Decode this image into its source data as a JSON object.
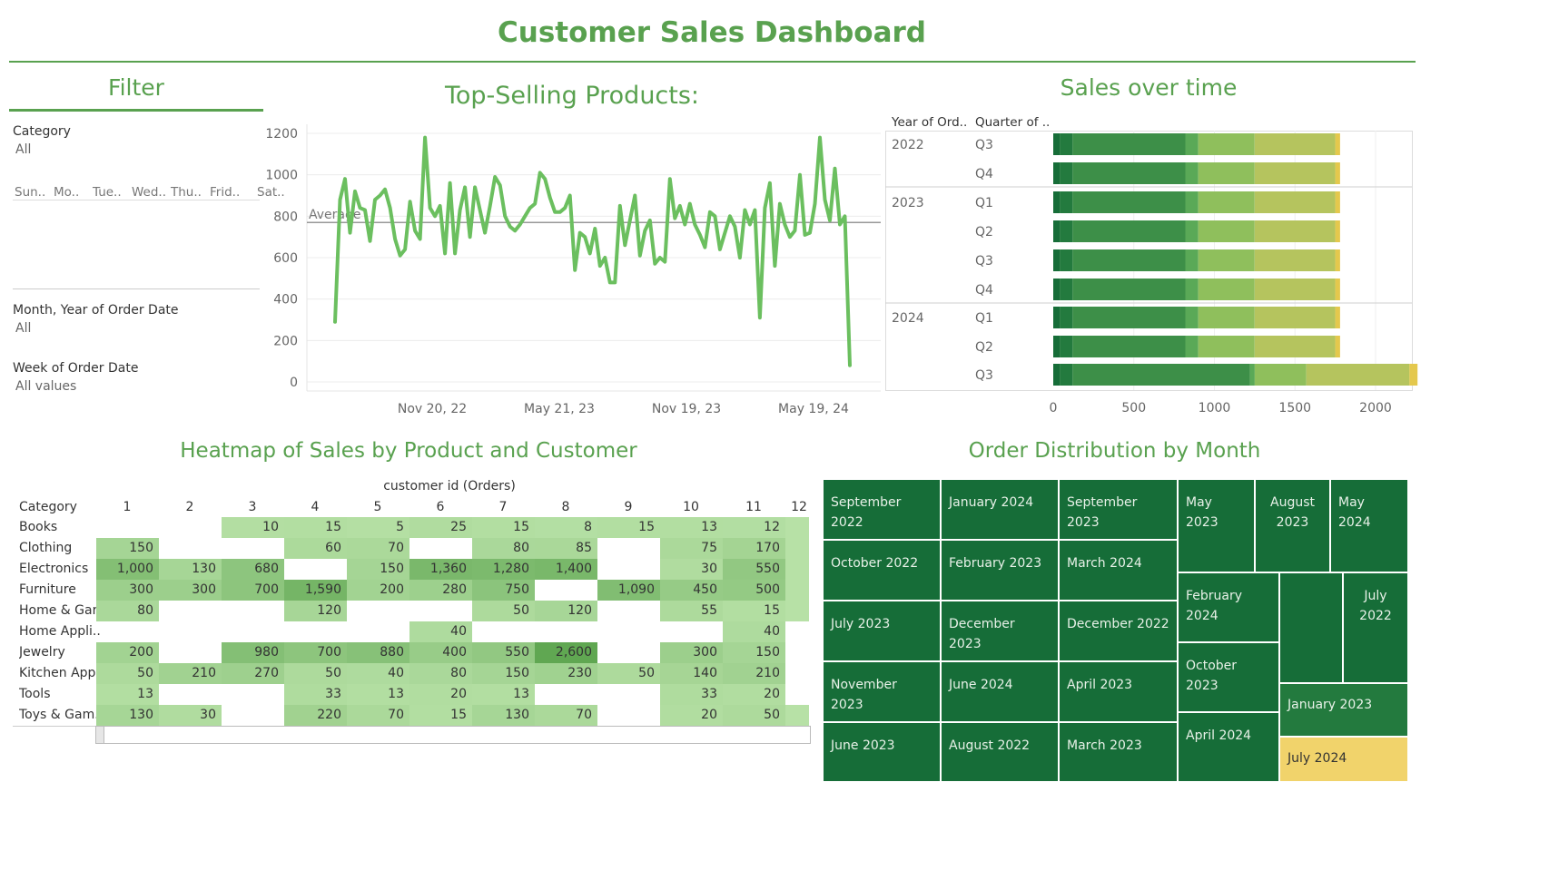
{
  "dashboard": {
    "title": "Customer Sales Dashboard"
  },
  "filter": {
    "title": "Filter",
    "category_label": "Category",
    "category_value": "All",
    "days": [
      "Sun..",
      "Mo..",
      "Tue..",
      "Wed..",
      "Thu..",
      "Frid..",
      "Sat.."
    ],
    "month_label": "Month, Year of Order Date",
    "month_value": "All",
    "week_label": "Week of Order Date",
    "week_value": "All values"
  },
  "line_chart": {
    "title": "Top-Selling Products:",
    "average_label": "Average",
    "y_ticks": [
      "1200",
      "1000",
      "800",
      "600",
      "400",
      "200",
      "0"
    ],
    "x_ticks": [
      "Nov 20, 22",
      "May 21, 23",
      "Nov 19, 23",
      "May 19, 24"
    ]
  },
  "bar_chart": {
    "title": "Sales over time",
    "col_year": "Year of Ord..",
    "col_quarter": "Quarter of ..",
    "x_ticks": [
      "0",
      "500",
      "1000",
      "1500",
      "2000"
    ],
    "rows": [
      {
        "year": "2022",
        "quarter": "Q3"
      },
      {
        "year": "",
        "quarter": "Q4"
      },
      {
        "year": "2023",
        "quarter": "Q1"
      },
      {
        "year": "",
        "quarter": "Q2"
      },
      {
        "year": "",
        "quarter": "Q3"
      },
      {
        "year": "",
        "quarter": "Q4"
      },
      {
        "year": "2024",
        "quarter": "Q1"
      },
      {
        "year": "",
        "quarter": "Q2"
      },
      {
        "year": "",
        "quarter": "Q3"
      }
    ]
  },
  "heatmap": {
    "title": "Heatmap of Sales by Product and Customer",
    "col_header": "customer id (Orders)",
    "row_header": "Category",
    "columns": [
      "1",
      "2",
      "3",
      "4",
      "5",
      "6",
      "7",
      "8",
      "9",
      "10",
      "11",
      "12"
    ],
    "rows": [
      {
        "label": "Books",
        "values": [
          null,
          null,
          10,
          15,
          5,
          25,
          15,
          8,
          15,
          13,
          12,
          null
        ]
      },
      {
        "label": "Clothing",
        "values": [
          150,
          null,
          null,
          60,
          70,
          null,
          80,
          85,
          null,
          75,
          170,
          null
        ]
      },
      {
        "label": "Electronics",
        "values": [
          1000,
          130,
          680,
          null,
          150,
          1360,
          1280,
          1400,
          null,
          30,
          550,
          null
        ]
      },
      {
        "label": "Furniture",
        "values": [
          300,
          300,
          700,
          1590,
          200,
          280,
          750,
          null,
          1090,
          450,
          500,
          null
        ]
      },
      {
        "label": "Home & Gar..",
        "values": [
          80,
          null,
          null,
          120,
          null,
          null,
          50,
          120,
          null,
          55,
          15,
          null
        ]
      },
      {
        "label": "Home Appli..",
        "values": [
          null,
          null,
          null,
          null,
          null,
          40,
          null,
          null,
          null,
          null,
          40,
          null
        ]
      },
      {
        "label": "Jewelry",
        "values": [
          200,
          null,
          980,
          700,
          880,
          400,
          550,
          2600,
          null,
          300,
          150,
          null
        ]
      },
      {
        "label": "Kitchen App..",
        "values": [
          50,
          210,
          270,
          50,
          40,
          80,
          150,
          230,
          50,
          140,
          210,
          null
        ]
      },
      {
        "label": "Tools",
        "values": [
          13,
          null,
          null,
          33,
          13,
          20,
          13,
          null,
          null,
          33,
          20,
          null
        ]
      },
      {
        "label": "Toys & Gam..",
        "values": [
          130,
          30,
          null,
          220,
          70,
          15,
          130,
          70,
          null,
          20,
          50,
          null
        ]
      }
    ],
    "display": [
      [
        null,
        null,
        "10",
        "15",
        "5",
        "25",
        "15",
        "8",
        "15",
        "13",
        "12",
        null
      ],
      [
        "150",
        null,
        null,
        "60",
        "70",
        null,
        "80",
        "85",
        null,
        "75",
        "170",
        null
      ],
      [
        "1,000",
        "130",
        "680",
        null,
        "150",
        "1,360",
        "1,280",
        "1,400",
        null,
        "30",
        "550",
        null
      ],
      [
        "300",
        "300",
        "700",
        "1,590",
        "200",
        "280",
        "750",
        null,
        "1,090",
        "450",
        "500",
        null
      ],
      [
        "80",
        null,
        null,
        "120",
        null,
        null,
        "50",
        "120",
        null,
        "55",
        "15",
        null
      ],
      [
        null,
        null,
        null,
        null,
        null,
        "40",
        null,
        null,
        null,
        null,
        "40",
        null
      ],
      [
        "200",
        null,
        "980",
        "700",
        "880",
        "400",
        "550",
        "2,600",
        null,
        "300",
        "150",
        null
      ],
      [
        "50",
        "210",
        "270",
        "50",
        "40",
        "80",
        "150",
        "230",
        "50",
        "140",
        "210",
        null
      ],
      [
        "13",
        null,
        null,
        "33",
        "13",
        "20",
        "13",
        null,
        null,
        "33",
        "20",
        null
      ],
      [
        "130",
        "30",
        null,
        "220",
        "70",
        "15",
        "130",
        "70",
        null,
        "20",
        "50",
        null
      ]
    ],
    "fill_only": [
      [
        false,
        false,
        false,
        false,
        false,
        false,
        false,
        false,
        false,
        false,
        false,
        true
      ],
      [
        false,
        false,
        false,
        false,
        false,
        false,
        false,
        false,
        false,
        false,
        false,
        true
      ],
      [
        false,
        false,
        false,
        false,
        false,
        false,
        false,
        false,
        false,
        false,
        false,
        true
      ],
      [
        false,
        false,
        false,
        false,
        false,
        false,
        false,
        false,
        false,
        false,
        false,
        true
      ],
      [
        false,
        false,
        false,
        false,
        false,
        false,
        false,
        false,
        false,
        false,
        false,
        true
      ],
      [
        false,
        false,
        false,
        false,
        false,
        false,
        false,
        false,
        false,
        false,
        false,
        false
      ],
      [
        false,
        false,
        false,
        false,
        false,
        false,
        false,
        false,
        false,
        false,
        false,
        false
      ],
      [
        false,
        false,
        false,
        false,
        false,
        false,
        false,
        false,
        false,
        false,
        false,
        false
      ],
      [
        false,
        false,
        false,
        false,
        false,
        false,
        false,
        false,
        false,
        false,
        false,
        false
      ],
      [
        false,
        false,
        false,
        false,
        false,
        false,
        false,
        false,
        false,
        false,
        false,
        true
      ]
    ]
  },
  "treemap": {
    "title": "Order Distribution by Month",
    "cells": [
      {
        "label": "September 2022"
      },
      {
        "label": "January 2024"
      },
      {
        "label": "September 2023"
      },
      {
        "label": "October 2022"
      },
      {
        "label": "February 2023"
      },
      {
        "label": "March 2024"
      },
      {
        "label": "July 2023"
      },
      {
        "label": "December 2023"
      },
      {
        "label": "December 2022"
      },
      {
        "label": "November 2023"
      },
      {
        "label": "June 2024"
      },
      {
        "label": "April 2023"
      },
      {
        "label": "June 2023"
      },
      {
        "label": "August 2022"
      },
      {
        "label": "March 2023"
      },
      {
        "label": "May 2023"
      },
      {
        "label": "August\n2023"
      },
      {
        "label": "May 2024"
      },
      {
        "label": "February 2024"
      },
      {
        "label": ""
      },
      {
        "label": "July\n2022"
      },
      {
        "label": "October 2023"
      },
      {
        "label": "January 2023"
      },
      {
        "label": "April 2024"
      },
      {
        "label": "July 2024"
      }
    ]
  },
  "colors": {
    "accent": "#59a14f",
    "line": "#6bbf5f",
    "treemap_dark": "#166d38",
    "treemap_mid": "#237a3e",
    "treemap_highlight": "#f1d36b"
  },
  "chart_data": [
    {
      "type": "line",
      "title": "Top-Selling Products:",
      "x_ticks": [
        "Nov 20, 22",
        "May 21, 23",
        "Nov 19, 23",
        "May 19, 24"
      ],
      "ylim": [
        0,
        1200
      ],
      "reference_line": {
        "label": "Average",
        "value": 770
      },
      "values": [
        290,
        880,
        980,
        720,
        920,
        840,
        830,
        680,
        880,
        900,
        930,
        840,
        690,
        610,
        640,
        870,
        730,
        690,
        1180,
        840,
        800,
        850,
        620,
        960,
        620,
        830,
        940,
        700,
        940,
        830,
        720,
        850,
        990,
        950,
        800,
        750,
        730,
        760,
        800,
        840,
        860,
        1010,
        980,
        890,
        820,
        820,
        840,
        900,
        540,
        720,
        700,
        620,
        740,
        560,
        600,
        480,
        480,
        850,
        660,
        780,
        900,
        610,
        730,
        780,
        570,
        600,
        580,
        980,
        790,
        850,
        760,
        860,
        760,
        710,
        650,
        820,
        800,
        640,
        720,
        800,
        750,
        600,
        830,
        760,
        830,
        310,
        840,
        960,
        560,
        860,
        760,
        700,
        730,
        1000,
        710,
        720,
        860,
        1180,
        880,
        780,
        1030,
        760,
        800,
        80
      ]
    },
    {
      "type": "bar",
      "title": "Sales over time",
      "orientation": "horizontal",
      "stacked": true,
      "categories": [
        "2022 Q3",
        "2022 Q4",
        "2023 Q1",
        "2023 Q2",
        "2023 Q3",
        "2023 Q4",
        "2024 Q1",
        "2024 Q2",
        "2024 Q3"
      ],
      "segment_colors": [
        "#166d38",
        "#237a3e",
        "#3d8f48",
        "#5aa957",
        "#8fbf5c",
        "#b5c45e",
        "#e4c84d"
      ],
      "segments": [
        [
          40,
          40,
          40,
          40,
          40,
          40,
          40,
          40,
          40
        ],
        [
          80,
          80,
          80,
          80,
          80,
          80,
          80,
          80,
          80
        ],
        [
          700,
          700,
          700,
          700,
          700,
          700,
          700,
          700,
          1100
        ],
        [
          80,
          80,
          80,
          80,
          80,
          80,
          80,
          80,
          30
        ],
        [
          350,
          350,
          350,
          350,
          350,
          350,
          350,
          350,
          320
        ],
        [
          500,
          500,
          500,
          500,
          500,
          500,
          500,
          500,
          640
        ],
        [
          30,
          30,
          30,
          30,
          30,
          30,
          30,
          30,
          50
        ]
      ],
      "xlim": [
        0,
        2200
      ]
    }
  ]
}
